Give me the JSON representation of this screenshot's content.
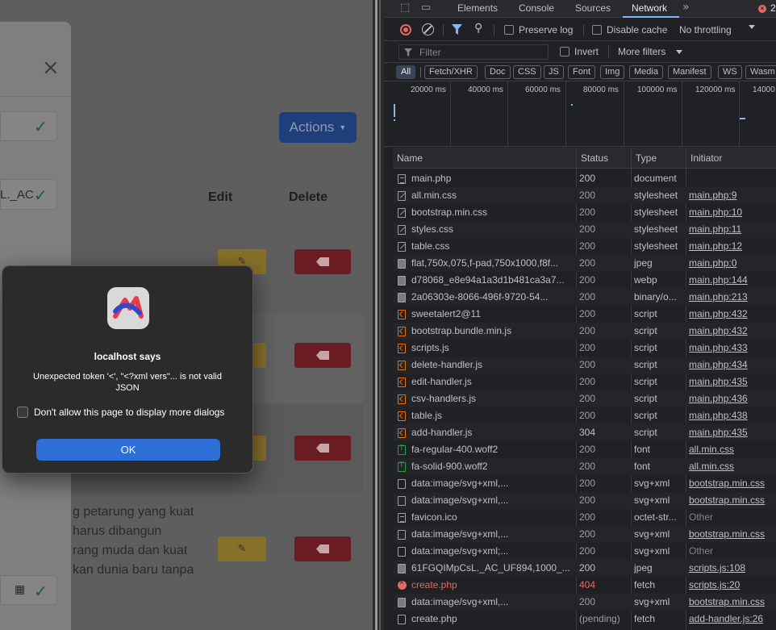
{
  "page": {
    "actions_label": "Actions",
    "col_edit": "Edit",
    "col_delete": "Delete",
    "field1_value": "L._AC",
    "paragraph_lines": [
      "g petarung yang kuat",
      "harus dibangun",
      "rang muda dan kuat",
      "kan dunia baru tanpa"
    ]
  },
  "dialog": {
    "title": "localhost says",
    "message": "Unexpected token '<', \"<?xml vers\"... is not valid JSON",
    "checkbox_label": "Don't allow this page to display more dialogs",
    "ok_label": "OK"
  },
  "devtools": {
    "tabs": [
      "Elements",
      "Console",
      "Sources",
      "Network"
    ],
    "active_tab": "Network",
    "error_count": "2",
    "toolbar": {
      "preserve_log": "Preserve log",
      "disable_cache": "Disable cache",
      "throttling": "No throttling"
    },
    "filter": {
      "placeholder": "Filter",
      "invert": "Invert",
      "more_filters": "More filters"
    },
    "type_filters": [
      "All",
      "Fetch/XHR",
      "Doc",
      "CSS",
      "JS",
      "Font",
      "Img",
      "Media",
      "Manifest",
      "WS",
      "Wasm"
    ],
    "overview_ticks": [
      "20000 ms",
      "40000 ms",
      "60000 ms",
      "80000 ms",
      "100000 ms",
      "120000 ms",
      "14000"
    ],
    "columns": [
      "Name",
      "Status",
      "Type",
      "Initiator"
    ],
    "requests": [
      {
        "name": "main.php",
        "status": "200",
        "type": "document",
        "initiator": "",
        "icon": "doc"
      },
      {
        "name": "all.min.css",
        "status": "200",
        "type": "stylesheet",
        "initiator": "main.php:9",
        "icon": "css"
      },
      {
        "name": "bootstrap.min.css",
        "status": "200",
        "type": "stylesheet",
        "initiator": "main.php:10",
        "icon": "css"
      },
      {
        "name": "styles.css",
        "status": "200",
        "type": "stylesheet",
        "initiator": "main.php:11",
        "icon": "css"
      },
      {
        "name": "table.css",
        "status": "200",
        "type": "stylesheet",
        "initiator": "main.php:12",
        "icon": "css"
      },
      {
        "name": "flat,750x,075,f-pad,750x1000,f8f...",
        "status": "200",
        "type": "jpeg",
        "initiator": "main.php:0",
        "icon": "img"
      },
      {
        "name": "d78068_e8e94a1a3d1b481ca3a7...",
        "status": "200",
        "type": "webp",
        "initiator": "main.php:144",
        "icon": "img"
      },
      {
        "name": "2a06303e-8066-496f-9720-54...",
        "status": "200",
        "type": "binary/o...",
        "initiator": "main.php:213",
        "icon": "img"
      },
      {
        "name": "sweetalert2@11",
        "status": "200",
        "type": "script",
        "initiator": "main.php:432",
        "icon": "script"
      },
      {
        "name": "bootstrap.bundle.min.js",
        "status": "200",
        "type": "script",
        "initiator": "main.php:432",
        "icon": "script"
      },
      {
        "name": "scripts.js",
        "status": "200",
        "type": "script",
        "initiator": "main.php:433",
        "icon": "script"
      },
      {
        "name": "delete-handler.js",
        "status": "200",
        "type": "script",
        "initiator": "main.php:434",
        "icon": "script"
      },
      {
        "name": "edit-handler.js",
        "status": "200",
        "type": "script",
        "initiator": "main.php:435",
        "icon": "script"
      },
      {
        "name": "csv-handlers.js",
        "status": "200",
        "type": "script",
        "initiator": "main.php:436",
        "icon": "script"
      },
      {
        "name": "table.js",
        "status": "200",
        "type": "script",
        "initiator": "main.php:438",
        "icon": "script"
      },
      {
        "name": "add-handler.js",
        "status": "304",
        "type": "script",
        "initiator": "main.php:435",
        "icon": "script"
      },
      {
        "name": "fa-regular-400.woff2",
        "status": "200",
        "type": "font",
        "initiator": "all.min.css",
        "icon": "font"
      },
      {
        "name": "fa-solid-900.woff2",
        "status": "200",
        "type": "font",
        "initiator": "all.min.css",
        "icon": "font"
      },
      {
        "name": "data:image/svg+xml,...",
        "status": "200",
        "type": "svg+xml",
        "initiator": "bootstrap.min.css",
        "icon": "blank"
      },
      {
        "name": "data:image/svg+xml,...",
        "status": "200",
        "type": "svg+xml",
        "initiator": "bootstrap.min.css",
        "icon": "blank"
      },
      {
        "name": "favicon.ico",
        "status": "200",
        "type": "octet-str...",
        "initiator": "Other",
        "icon": "doc"
      },
      {
        "name": "data:image/svg+xml,...",
        "status": "200",
        "type": "svg+xml",
        "initiator": "bootstrap.min.css",
        "icon": "blank"
      },
      {
        "name": "data:image/svg+xml;...",
        "status": "200",
        "type": "svg+xml",
        "initiator": "Other",
        "icon": "blank"
      },
      {
        "name": "61FGQIMpCsL._AC_UF894,1000_...",
        "status": "200",
        "type": "jpeg",
        "initiator": "scripts.js:108",
        "icon": "img"
      },
      {
        "name": "create.php",
        "status": "404",
        "type": "fetch",
        "initiator": "scripts.js:20",
        "icon": "errdot"
      },
      {
        "name": "data:image/svg+xml,...",
        "status": "200",
        "type": "svg+xml",
        "initiator": "bootstrap.min.css",
        "icon": "img"
      },
      {
        "name": "create.php",
        "status": "(pending)",
        "type": "fetch",
        "initiator": "add-handler.js:26",
        "icon": "blank"
      }
    ]
  }
}
